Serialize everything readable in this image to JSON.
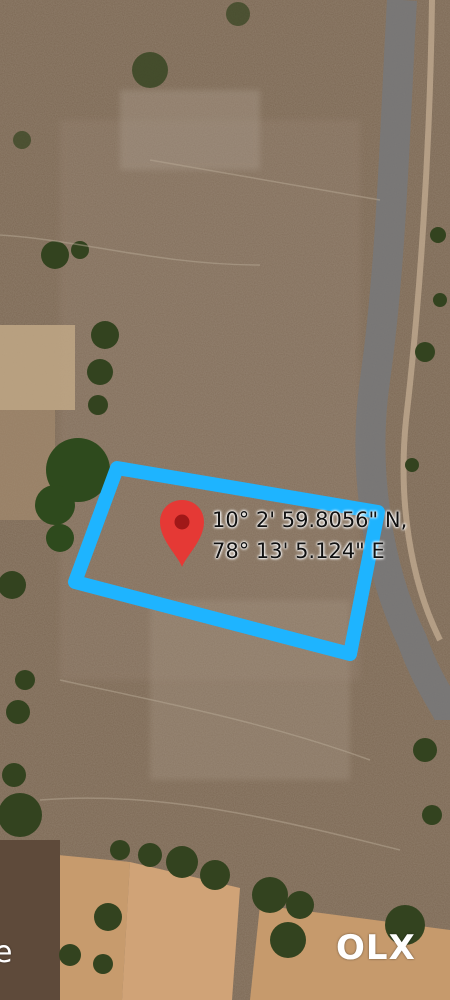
{
  "map": {
    "type": "satellite",
    "pin": {
      "icon": "map-pin-icon",
      "color": "#e53935"
    },
    "coordinates": {
      "latitude": "10° 2' 59.8056\" N,",
      "longitude": "78° 13' 5.124\" E"
    },
    "plot_outline_color": "#1eb4ff"
  },
  "watermark": {
    "text": "OLX"
  },
  "edge_fragment": "e"
}
